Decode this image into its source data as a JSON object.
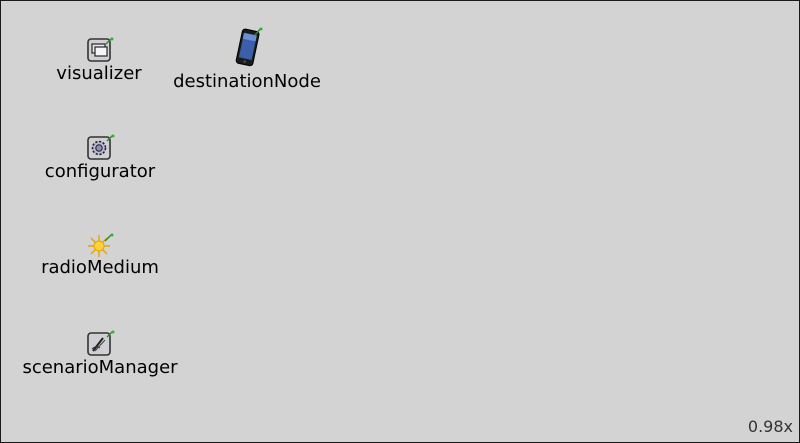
{
  "canvas": {
    "background": "#d3d3d3",
    "zoom_label": "0.98x"
  },
  "nodes": [
    {
      "id": "visualizer",
      "label": "visualizer",
      "icon": "window-icon"
    },
    {
      "id": "destinationNode",
      "label": "destinationNode",
      "icon": "smartphone-icon"
    },
    {
      "id": "configurator",
      "label": "configurator",
      "icon": "gear-icon"
    },
    {
      "id": "radioMedium",
      "label": "radioMedium",
      "icon": "sun-icon"
    },
    {
      "id": "scenarioManager",
      "label": "scenarioManager",
      "icon": "document-pen-icon"
    }
  ]
}
